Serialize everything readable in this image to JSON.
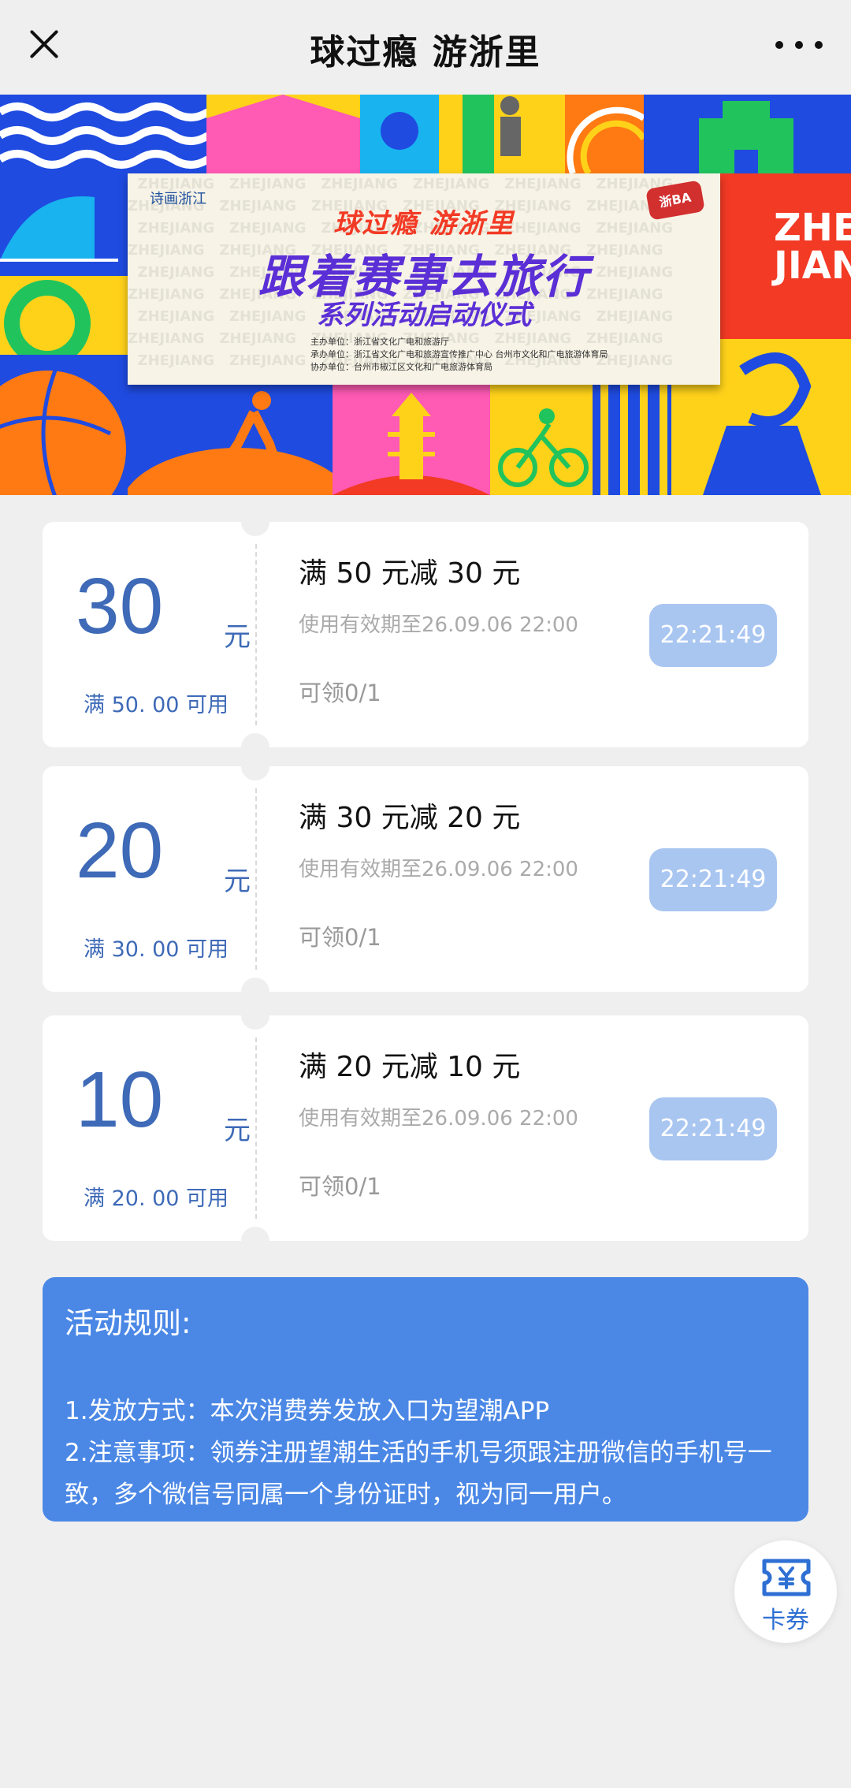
{
  "header": {
    "title": "球过瘾 游浙里"
  },
  "banner": {
    "logo_left": "诗画浙江",
    "logo_right": "浙BA",
    "slogan": "球过瘾  游浙里",
    "main_title": "跟着赛事去旅行",
    "sub_title": "系列活动启动仪式",
    "org_lines": [
      "主办单位：浙江省文化广电和旅游厅",
      "承办单位：浙江省文化广电和旅游宣传推广中心    台州市文化和广电旅游体育局",
      "协办单位：台州市椒江区文化和广电旅游体育局"
    ],
    "side_text": "ZHE JIANG",
    "watermark": "ZHEJIANG",
    "colors": {
      "blue": "#1f4be0",
      "yellow": "#ffd21a",
      "pink": "#ff5ab4",
      "orange": "#ff7a12",
      "green": "#21c35d",
      "red": "#f23a25",
      "purple": "#5b2fd6"
    }
  },
  "coupons": [
    {
      "amount": "30",
      "unit": "元",
      "threshold": "满 50. 00 可用",
      "title": "满 50 元减 30 元",
      "validity": "使用有效期至26.09.06 22:00",
      "claim": "可领0/1",
      "countdown": "22:21:49"
    },
    {
      "amount": "20",
      "unit": "元",
      "threshold": "满 30. 00 可用",
      "title": "满 30 元减 20 元",
      "validity": "使用有效期至26.09.06 22:00",
      "claim": "可领0/1",
      "countdown": "22:21:49"
    },
    {
      "amount": "10",
      "unit": "元",
      "threshold": "满 20. 00 可用",
      "title": "满 20 元减 10 元",
      "validity": "使用有效期至26.09.06 22:00",
      "claim": "可领0/1",
      "countdown": "22:21:49"
    }
  ],
  "rules": {
    "heading": "活动规则:",
    "line1": "1.发放方式：本次消费券发放入口为望潮APP",
    "line2": "2.注意事项：领券注册望潮生活的手机号须跟注册微信的手机号一致，多个微信号同属一个身份证时，视为同一用户。"
  },
  "float_button": {
    "label": "卡券",
    "icon": "ticket-yen-icon"
  },
  "colors": {
    "accent": "#3e6ab7",
    "rules_bg": "#4b88e6",
    "timer_bg": "#a9c6f1",
    "page_bg": "#efefef"
  }
}
